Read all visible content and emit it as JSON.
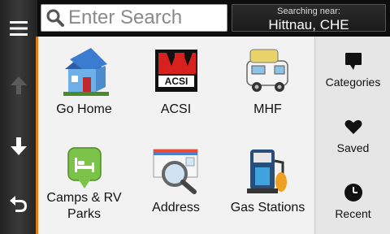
{
  "search": {
    "placeholder": "Enter Search"
  },
  "location": {
    "label": "Searching near:",
    "value": "Hittnau, CHE"
  },
  "grid": [
    {
      "label": "Go Home"
    },
    {
      "label": "ACSI"
    },
    {
      "label": "MHF"
    },
    {
      "label": "Camps & RV Parks"
    },
    {
      "label": "Address"
    },
    {
      "label": "Gas Stations"
    }
  ],
  "sidebar": [
    {
      "label": "Categories",
      "icon": "speech-bubble-icon"
    },
    {
      "label": "Saved",
      "icon": "heart-icon"
    },
    {
      "label": "Recent",
      "icon": "clock-icon"
    }
  ],
  "colors": {
    "accent": "#e87a10"
  }
}
